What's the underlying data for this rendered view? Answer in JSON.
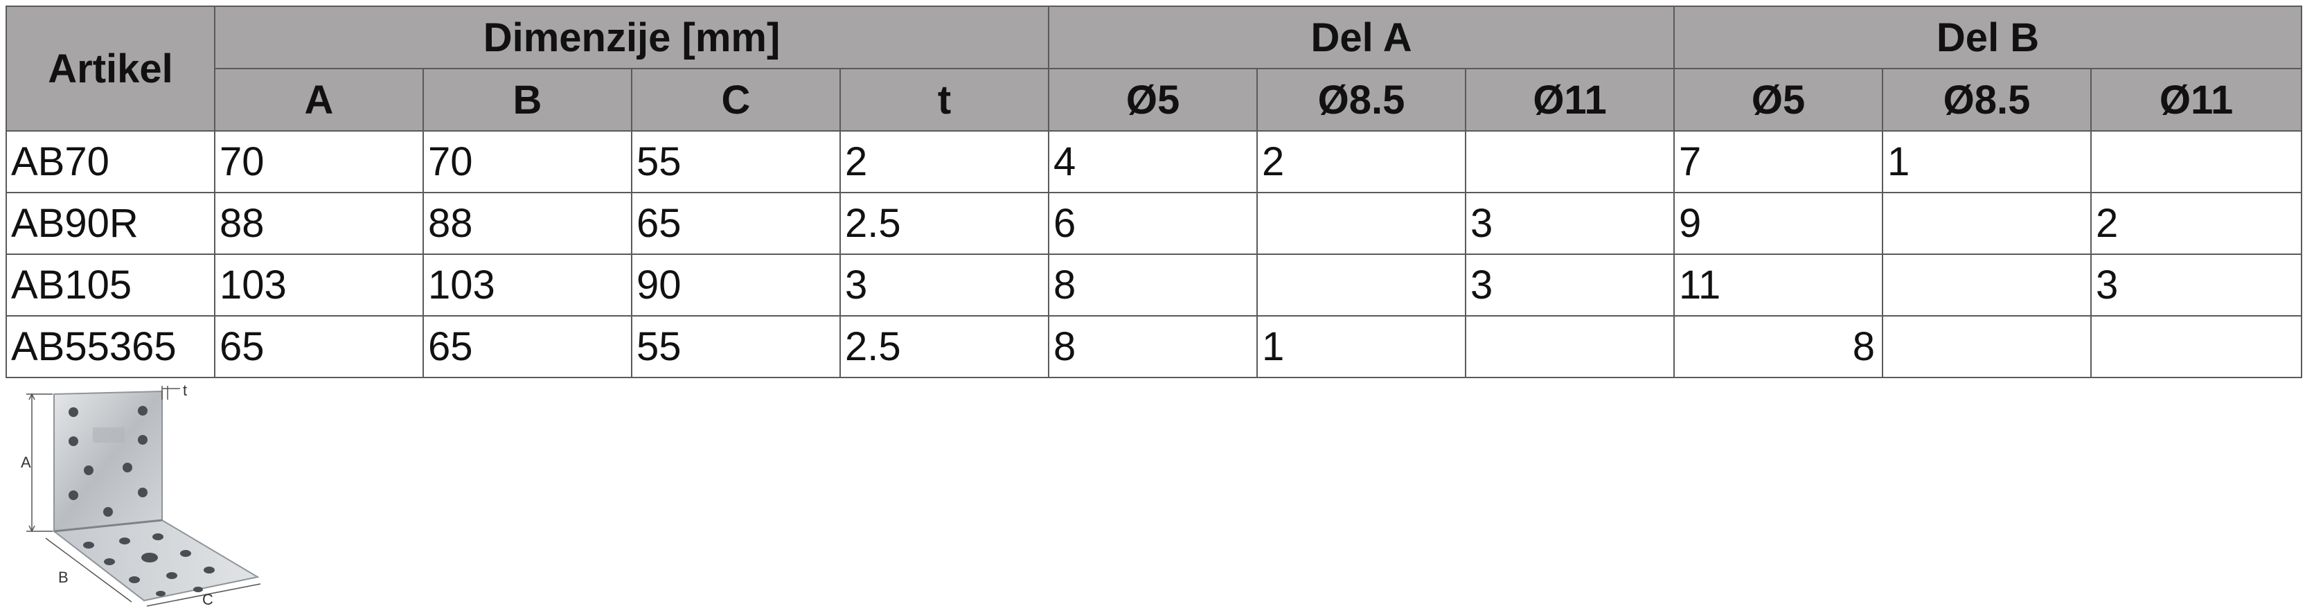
{
  "table": {
    "headers": {
      "artikel": "Artikel",
      "dimenzije": "Dimenzije [mm]",
      "del_a": "Del A",
      "del_b": "Del B",
      "sub": [
        "A",
        "B",
        "C",
        "t",
        "Ø5",
        "Ø8.5",
        "Ø11",
        "Ø5",
        "Ø8.5",
        "Ø11"
      ]
    },
    "rows": [
      [
        "AB70",
        "70",
        "70",
        "55",
        "2",
        "4",
        "2",
        "",
        "7",
        "1",
        ""
      ],
      [
        "AB90R",
        "88",
        "88",
        "65",
        "2.5",
        "6",
        "",
        "3",
        "9",
        "",
        "2"
      ],
      [
        "AB105",
        "103",
        "103",
        "90",
        "3",
        "8",
        "",
        "3",
        "11",
        "",
        "3"
      ],
      [
        "AB55365",
        "65",
        "65",
        "55",
        "2.5",
        "8",
        "1",
        "",
        "8",
        "",
        ""
      ]
    ]
  },
  "figure": {
    "labels": {
      "a": "A",
      "b": "B",
      "c": "C",
      "t": "t"
    }
  }
}
